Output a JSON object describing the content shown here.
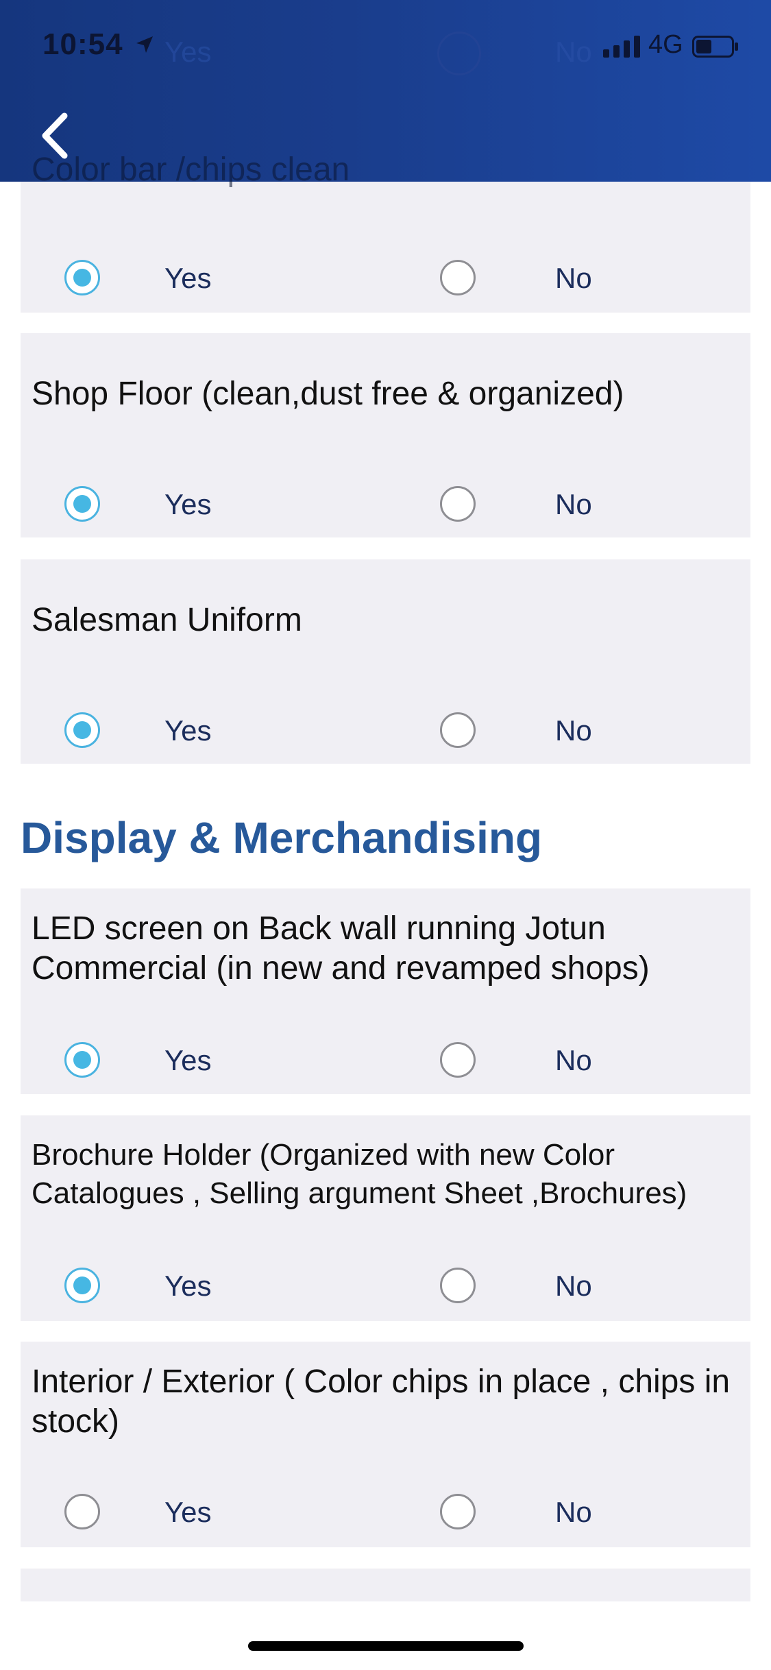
{
  "status_bar": {
    "time": "10:54",
    "network": "4G"
  },
  "header_ghost": {
    "yes": "Yes",
    "no": "No",
    "title": "Color bar /chips clean"
  },
  "options": {
    "yes": "Yes",
    "no": "No"
  },
  "questions": [
    {
      "text": "Color bar /chips clean",
      "selected": "Yes"
    },
    {
      "text": "Shop Floor (clean,dust free & organized)",
      "selected": "Yes"
    },
    {
      "text": "Salesman Uniform",
      "selected": "Yes"
    },
    {
      "text": "LED screen on Back wall running Jotun Commercial (in new and revamped shops)",
      "selected": "Yes"
    },
    {
      "text": "Brochure Holder (Organized with new Color Catalogues , Selling argument Sheet ,Brochures)",
      "selected": "Yes"
    },
    {
      "text": "Interior / Exterior ( Color chips in place , chips in stock)",
      "selected": null
    }
  ],
  "section": {
    "title": "Display & Merchandising"
  },
  "colors": {
    "accent": "#46b7e3",
    "header": "#1a3d8c",
    "section_title": "#27599a",
    "card_bg": "#f0eff4"
  }
}
